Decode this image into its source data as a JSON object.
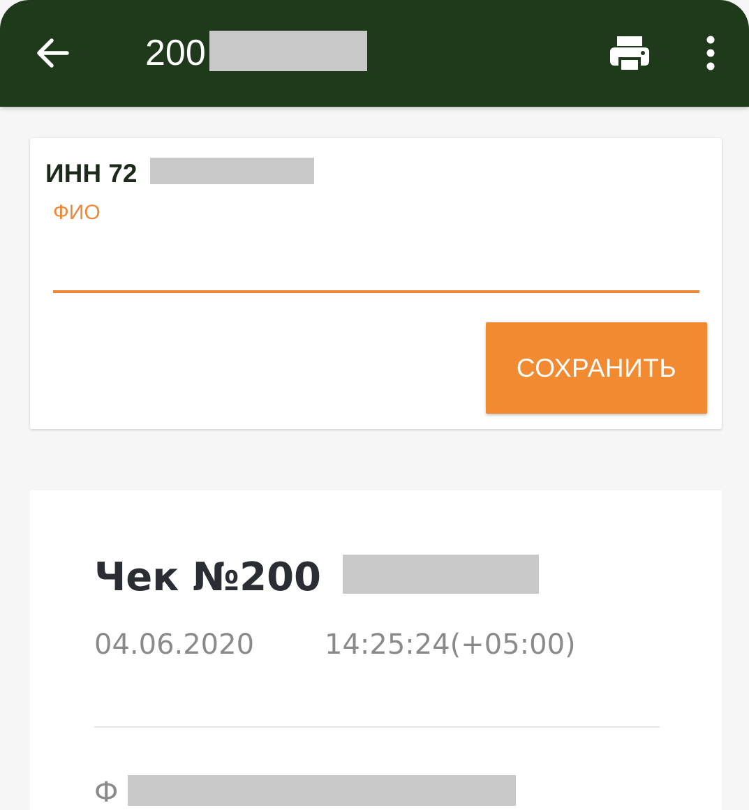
{
  "header": {
    "title_visible": "200",
    "back_icon": "arrow-left-icon",
    "print_icon": "printer-icon",
    "more_icon": "more-vert-icon",
    "background_color": "#1f3a1b"
  },
  "form": {
    "inn_label": "ИНН 72",
    "fio_label": "ФИО",
    "fio_value": "",
    "save_label": "СОХРАНИТЬ",
    "accent_color": "#f28a31"
  },
  "receipt": {
    "title_visible": "Чек №200",
    "date": "04.06.2020",
    "time": "14:25:24(+05:00)",
    "field_visible": "Ф"
  }
}
